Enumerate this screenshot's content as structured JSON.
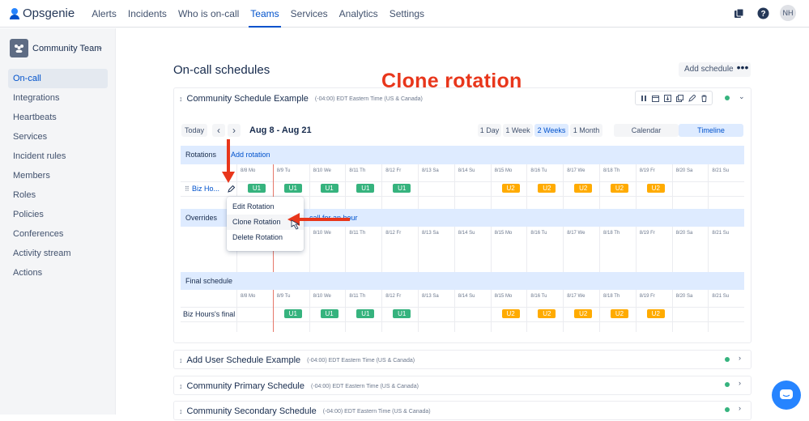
{
  "nav": {
    "brand": "Opsgenie",
    "items": [
      "Alerts",
      "Incidents",
      "Who is on-call",
      "Teams",
      "Services",
      "Analytics",
      "Settings"
    ],
    "active": "Teams",
    "avatar_initials": "NH"
  },
  "sidebar": {
    "team_name": "Community Team",
    "items": [
      "On-call",
      "Integrations",
      "Heartbeats",
      "Services",
      "Incident rules",
      "Members",
      "Roles",
      "Policies",
      "Conferences",
      "Activity stream",
      "Actions"
    ],
    "active": "On-call"
  },
  "page": {
    "title": "On-call schedules",
    "add_schedule": "Add schedule",
    "annotation": "Clone rotation"
  },
  "schedule": {
    "name": "Community Schedule Example",
    "tz": "(-04:00) EDT Eastern Time (US & Canada)",
    "today": "Today",
    "prev": "‹",
    "next": "›",
    "range": "Aug 8 - Aug 21",
    "periods": [
      "1 Day",
      "1 Week",
      "2 Weeks",
      "1 Month"
    ],
    "active_period": "2 Weeks",
    "views": [
      "Calendar",
      "Timeline"
    ],
    "active_view": "Timeline",
    "rotations_label": "Rotations",
    "add_rotation": "Add rotation",
    "overrides_label": "Overrides",
    "override_link_partial": "call for an hour",
    "final_label": "Final schedule",
    "rotation_name": "Biz Ho...",
    "final_row_name": "Biz Hours's final",
    "days": [
      "8/8 Mo",
      "8/9 Tu",
      "8/10 We",
      "8/11 Th",
      "8/12 Fr",
      "8/13 Sa",
      "8/14 Su",
      "8/15 Mo",
      "8/16 Tu",
      "8/17 We",
      "8/18 Th",
      "8/19 Fr",
      "8/20 Sa",
      "8/21 Su"
    ],
    "rotation_shifts": [
      "U1",
      "U1",
      "U1",
      "U1",
      "U1",
      "",
      "",
      "U2",
      "U2",
      "U2",
      "U2",
      "U2",
      "",
      ""
    ],
    "final_shifts": [
      "",
      "U1",
      "U1",
      "U1",
      "U1",
      "",
      "",
      "U2",
      "U2",
      "U2",
      "U2",
      "U2",
      "",
      ""
    ]
  },
  "menu": {
    "items": [
      "Edit Rotation",
      "Clone Rotation",
      "Delete Rotation"
    ],
    "highlighted": "Clone Rotation"
  },
  "other_schedules": [
    {
      "name": "Add User Schedule Example",
      "tz": "(-04:00) EDT Eastern Time (US & Canada)"
    },
    {
      "name": "Community Primary Schedule",
      "tz": "(-04:00) EDT Eastern Time (US & Canada)"
    },
    {
      "name": "Community Secondary Schedule",
      "tz": "(-04:00) EDT Eastern Time (US & Canada)"
    }
  ],
  "colors": {
    "accent": "#0052cc",
    "u1": "#36b37e",
    "u2": "#ffab00",
    "annotation": "#e8361b"
  }
}
